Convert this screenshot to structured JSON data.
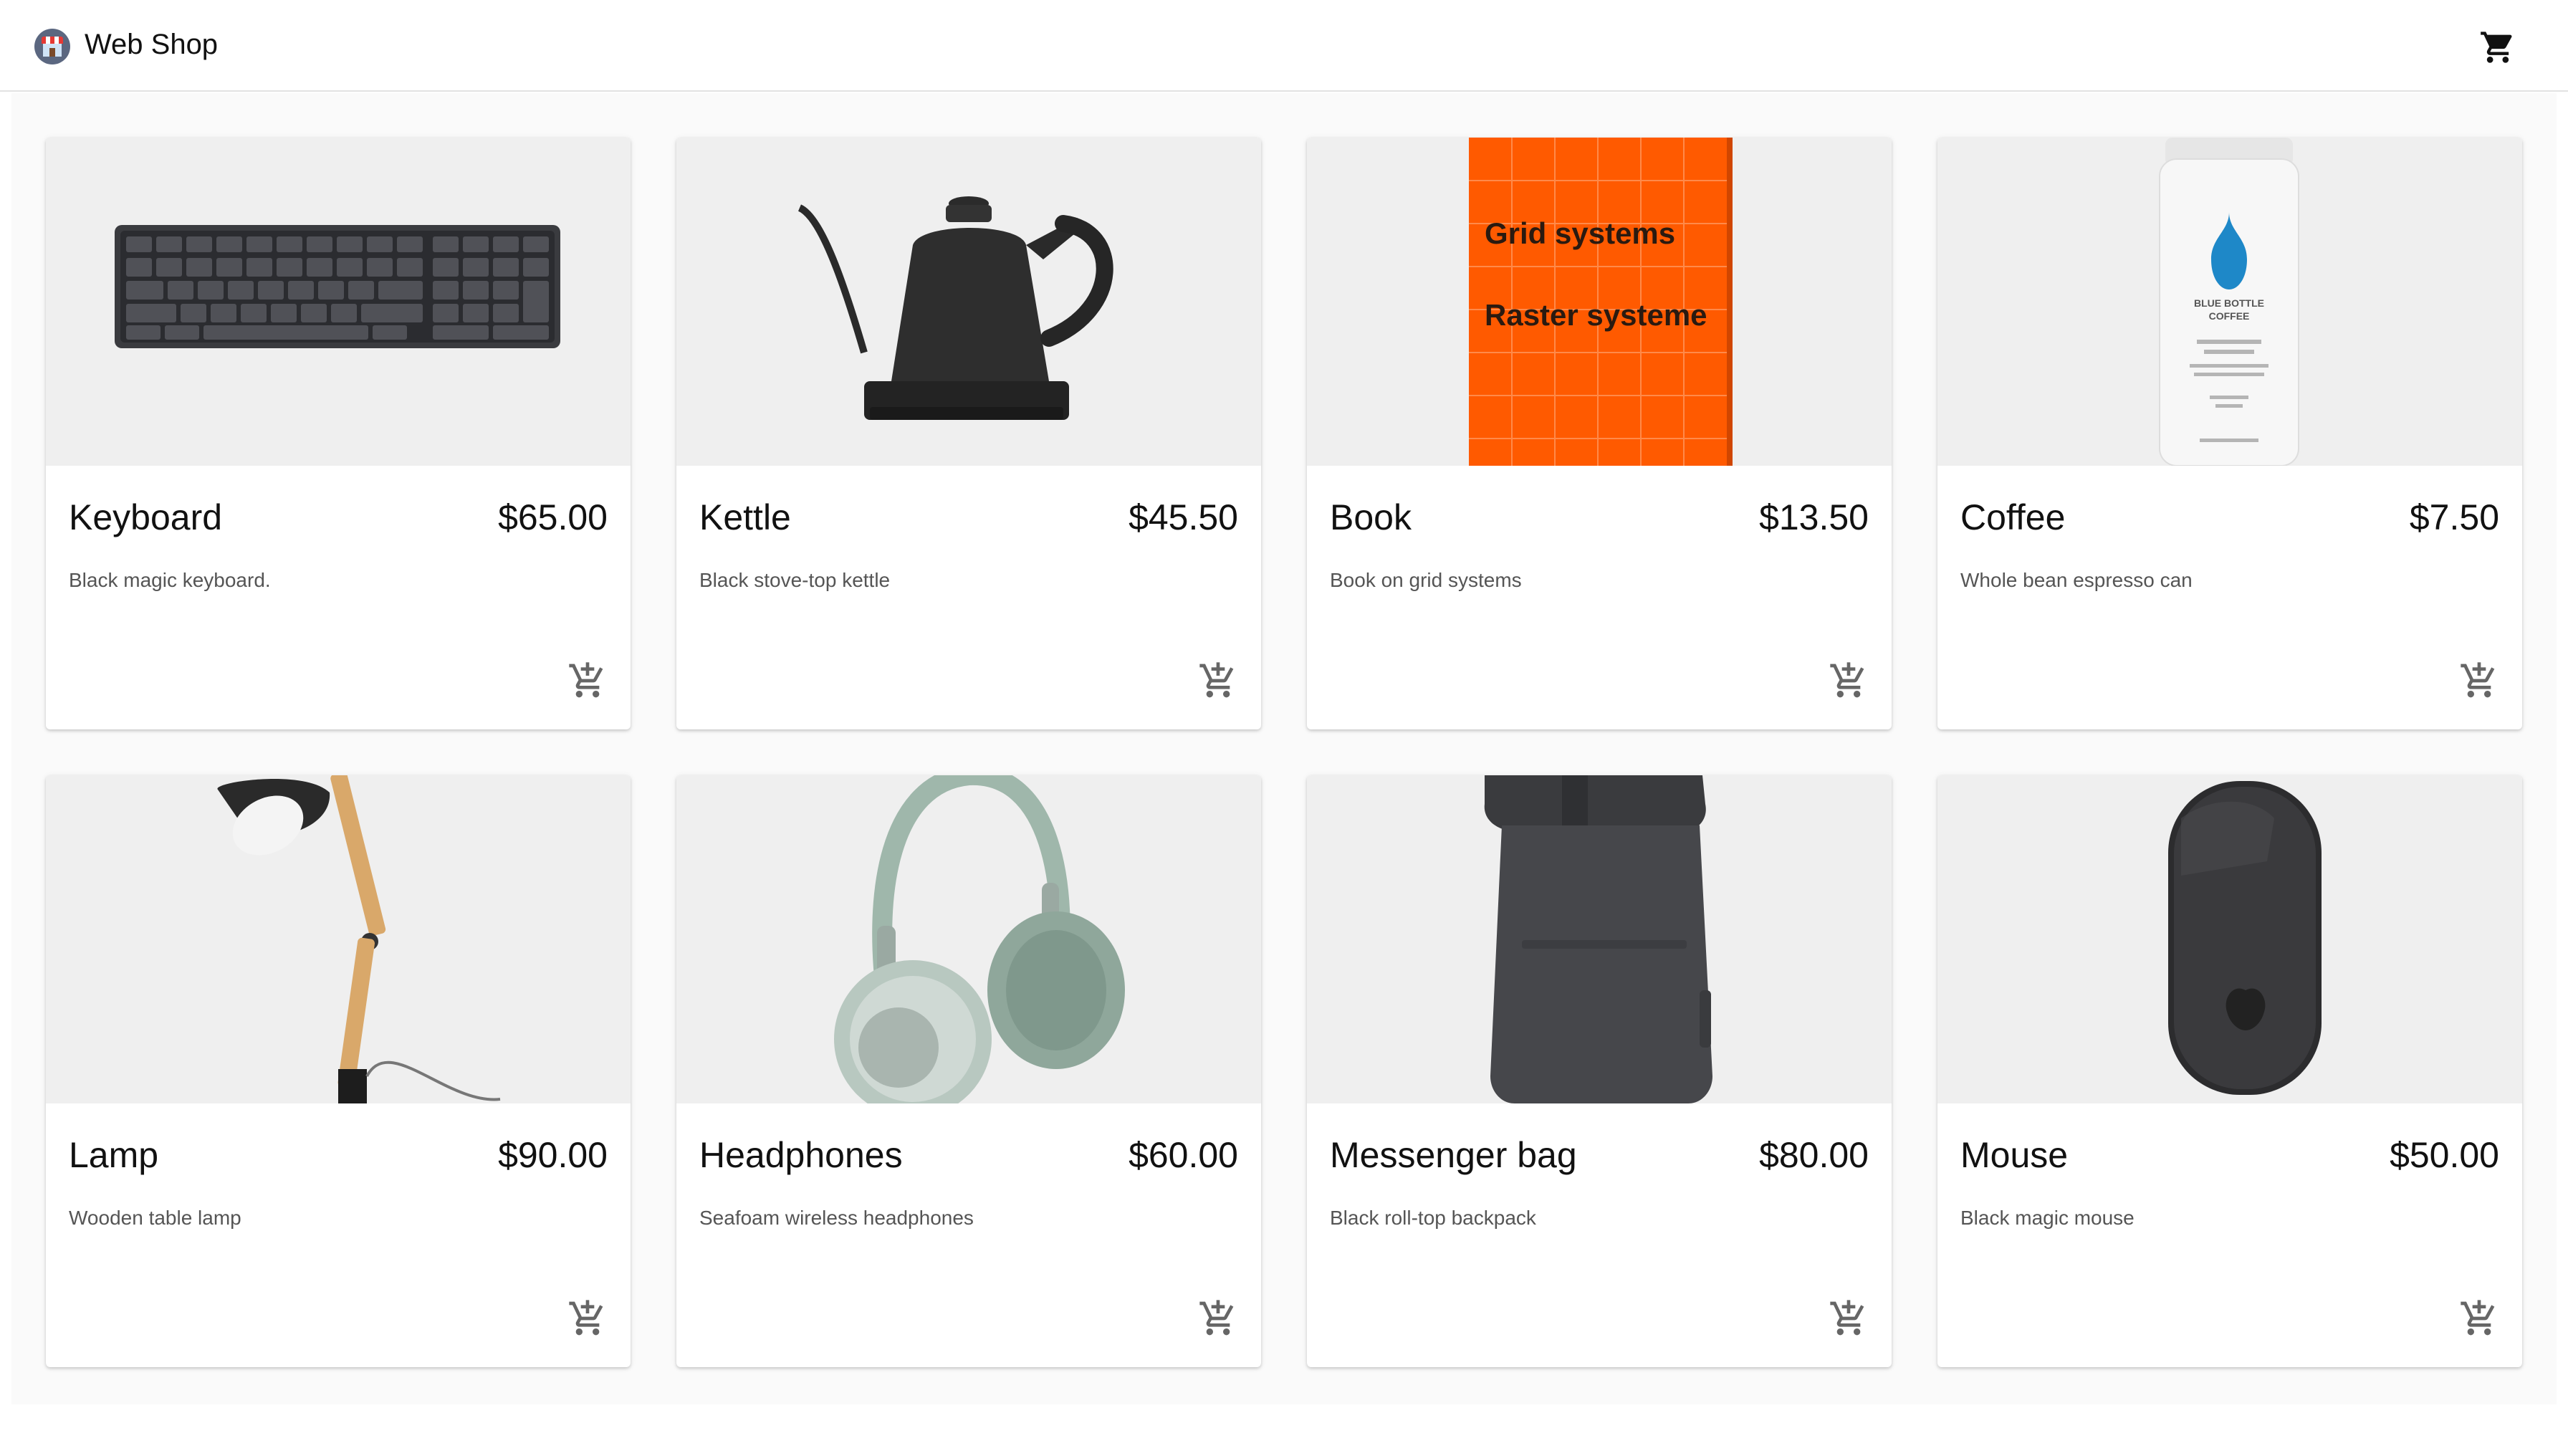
{
  "app": {
    "title": "Web Shop",
    "icons": {
      "logo": "store-icon",
      "cart": "shopping-cart-icon",
      "add": "add-shopping-cart-icon"
    },
    "colors": {
      "text": "#111111",
      "muted": "#555555",
      "background": "#fafafa",
      "book_cover": "#ff5a00"
    }
  },
  "products": [
    {
      "name": "Keyboard",
      "price": "$65.00",
      "description": "Black magic keyboard.",
      "image": "keyboard-image"
    },
    {
      "name": "Kettle",
      "price": "$45.50",
      "description": "Black stove-top kettle",
      "image": "kettle-image"
    },
    {
      "name": "Book",
      "price": "$13.50",
      "description": "Book on grid systems",
      "image": "book-image",
      "cover": {
        "line1": "Grid systems",
        "line2": "Raster systeme"
      }
    },
    {
      "name": "Coffee",
      "price": "$7.50",
      "description": "Whole bean espresso can",
      "image": "coffee-can-image",
      "label": {
        "line1": "BLUE BOTTLE",
        "line2": "COFFEE"
      }
    },
    {
      "name": "Lamp",
      "price": "$90.00",
      "description": "Wooden table lamp",
      "image": "lamp-image"
    },
    {
      "name": "Headphones",
      "price": "$60.00",
      "description": "Seafoam wireless headphones",
      "image": "headphones-image"
    },
    {
      "name": "Messenger bag",
      "price": "$80.00",
      "description": "Black roll-top backpack",
      "image": "backpack-image"
    },
    {
      "name": "Mouse",
      "price": "$50.00",
      "description": "Black magic mouse",
      "image": "mouse-image"
    }
  ]
}
